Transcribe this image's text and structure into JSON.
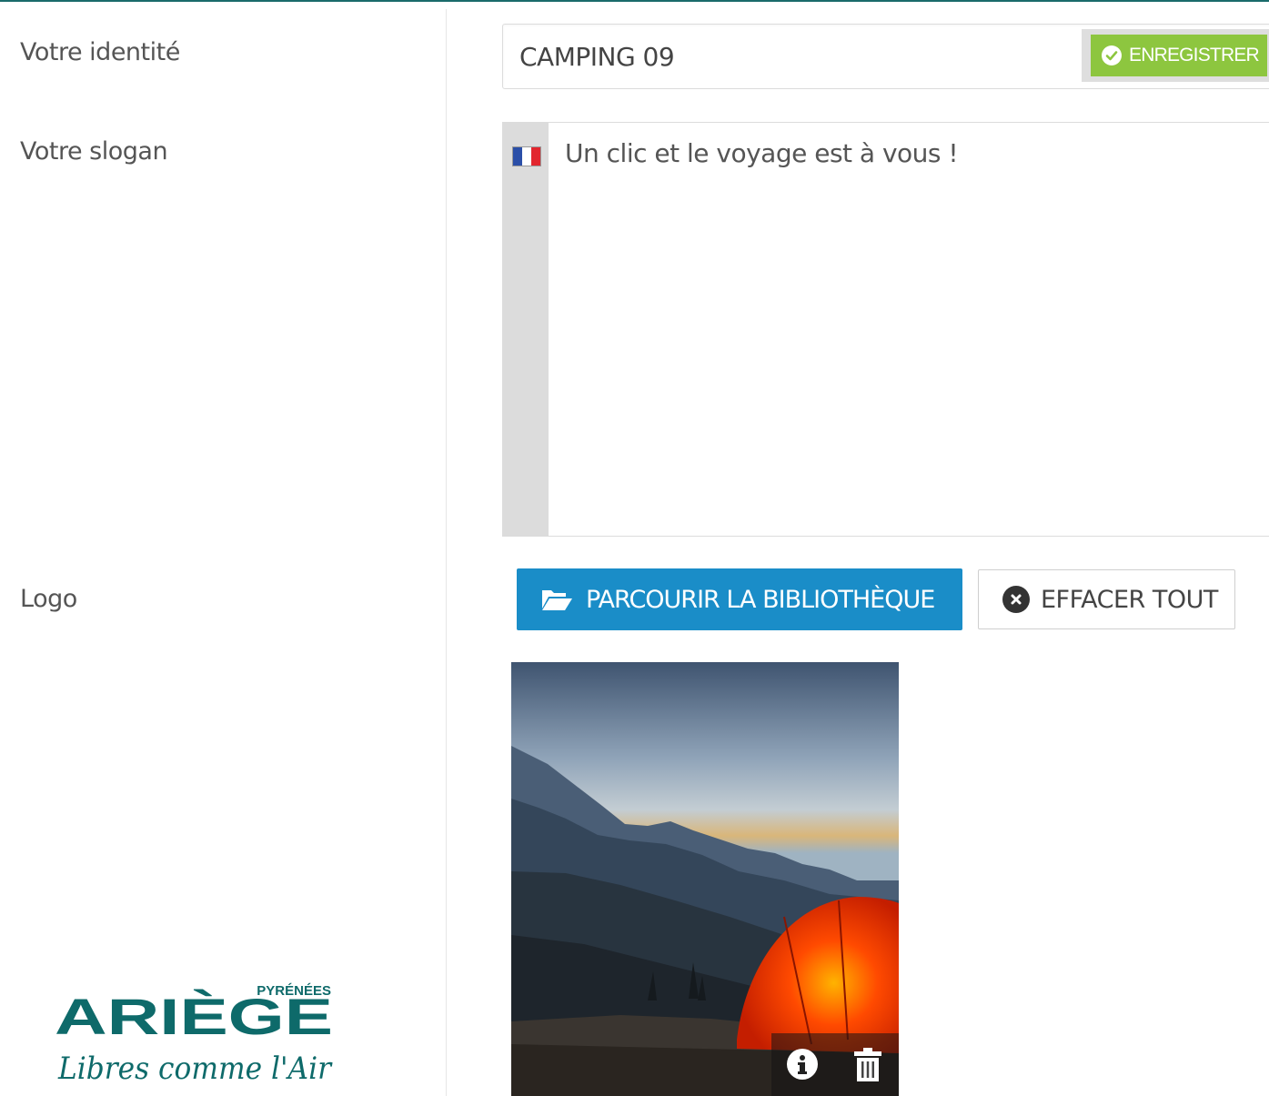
{
  "form": {
    "identity_label": "Votre identité",
    "identity_value": "CAMPING 09",
    "save_label": "ENREGISTRER",
    "slogan_label": "Votre slogan",
    "slogan_value": "Un clic et le voyage est à vous !",
    "slogan_language": "fr",
    "logo_label": "Logo",
    "browse_label": "PARCOURIR LA BIBLIOTHÈQUE",
    "clear_label": "EFFACER TOUT"
  },
  "brand": {
    "region_small": "PYRÉNÉES",
    "region": "ARIÈGE",
    "tagline": "Libres comme l'Air"
  },
  "icons": {
    "save": "check-circle-icon",
    "flag": "french-flag-icon",
    "browse": "folder-open-icon",
    "clear": "times-circle-icon",
    "image_info": "info-icon",
    "image_delete": "trash-icon"
  },
  "colors": {
    "save_button": "#8dc63f",
    "browse_button": "#1a8dc8",
    "top_rule": "#1a6b6b",
    "brand_teal": "#0e6a6a",
    "tent": "#ff3a00"
  }
}
